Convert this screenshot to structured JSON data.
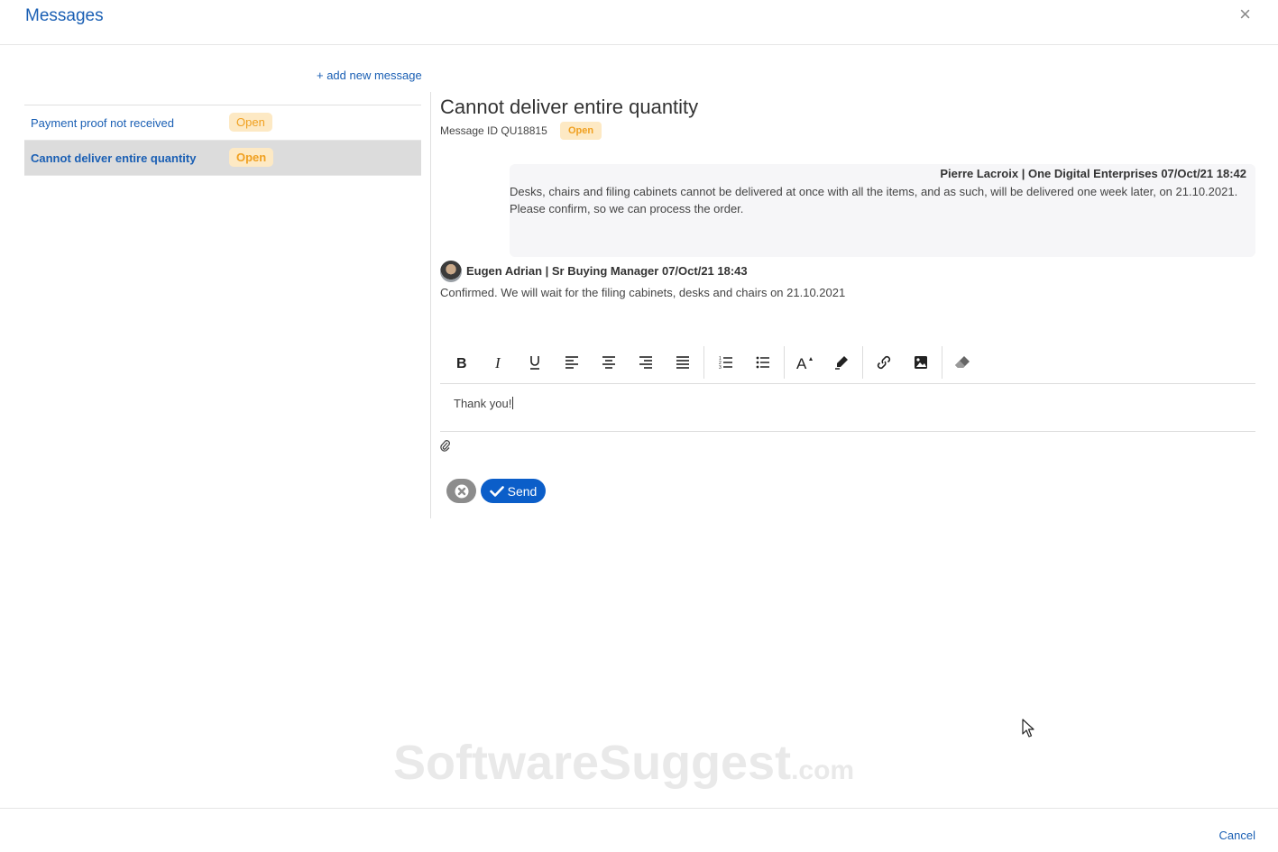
{
  "header": {
    "title": "Messages",
    "close_glyph": "×"
  },
  "sidebar": {
    "add_new_label": "+ add new message",
    "items": [
      {
        "subject": "Payment proof not received",
        "status": "Open",
        "active": false
      },
      {
        "subject": "Cannot deliver entire quantity",
        "status": "Open",
        "active": true
      }
    ]
  },
  "detail": {
    "title": "Cannot deliver entire quantity",
    "message_id_label": "Message ID",
    "message_id": "QU18815",
    "status": "Open",
    "messages": [
      {
        "author": "Pierre Lacroix | One Digital Enterprises 07/Oct/21 18:42",
        "lines": [
          "Desks, chairs and filing cabinets cannot be delivered at once with all the items, and as such, will be delivered one week later, on 21.10.2021.",
          "Please confirm, so we can process the order."
        ]
      },
      {
        "author": "Eugen Adrian | Sr Buying Manager 07/Oct/21 18:43",
        "body": "Confirmed. We will wait for the filing cabinets, desks and chairs on 21.10.2021"
      }
    ]
  },
  "toolbar": {
    "icons": [
      "bold-icon",
      "italic-icon",
      "underline-icon",
      "align-left-icon",
      "align-center-icon",
      "align-right-icon",
      "align-justify-icon",
      "ordered-list-icon",
      "bullet-list-icon",
      "font-size-icon",
      "highlighter-icon",
      "link-icon",
      "image-icon",
      "eraser-icon"
    ]
  },
  "editor": {
    "value": "Thank you!"
  },
  "actions": {
    "send_label": "Send"
  },
  "watermark": {
    "main": "SoftwareSuggest",
    "suffix": ".com"
  },
  "footer": {
    "cancel_label": "Cancel"
  },
  "colors": {
    "accent": "#1a5fb4",
    "send_button": "#0b5ec9",
    "badge_bg": "#fde9c4",
    "badge_text": "#f0a020",
    "active_row": "#dcdcdc"
  }
}
